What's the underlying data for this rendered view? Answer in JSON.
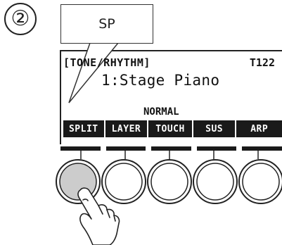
{
  "step": {
    "number": "②"
  },
  "callout": {
    "text": "SP"
  },
  "display": {
    "header": "[TONE/RHYTHM]",
    "tempo": "T122",
    "tone": "1:Stage Piano",
    "mode": "NORMAL"
  },
  "softkeys": [
    {
      "label": "SPLIT",
      "pressed": true
    },
    {
      "label": "LAYER",
      "pressed": false
    },
    {
      "label": "TOUCH",
      "pressed": false
    },
    {
      "label": "SUS",
      "pressed": false
    },
    {
      "label": "ARP",
      "pressed": false
    }
  ],
  "colors": {
    "pressed_button": "#cccccc",
    "label_bg": "#1a1a1a",
    "label_text": "#ffffff",
    "outline": "#222222"
  },
  "icons": {
    "hand": "pointing-hand-icon"
  }
}
